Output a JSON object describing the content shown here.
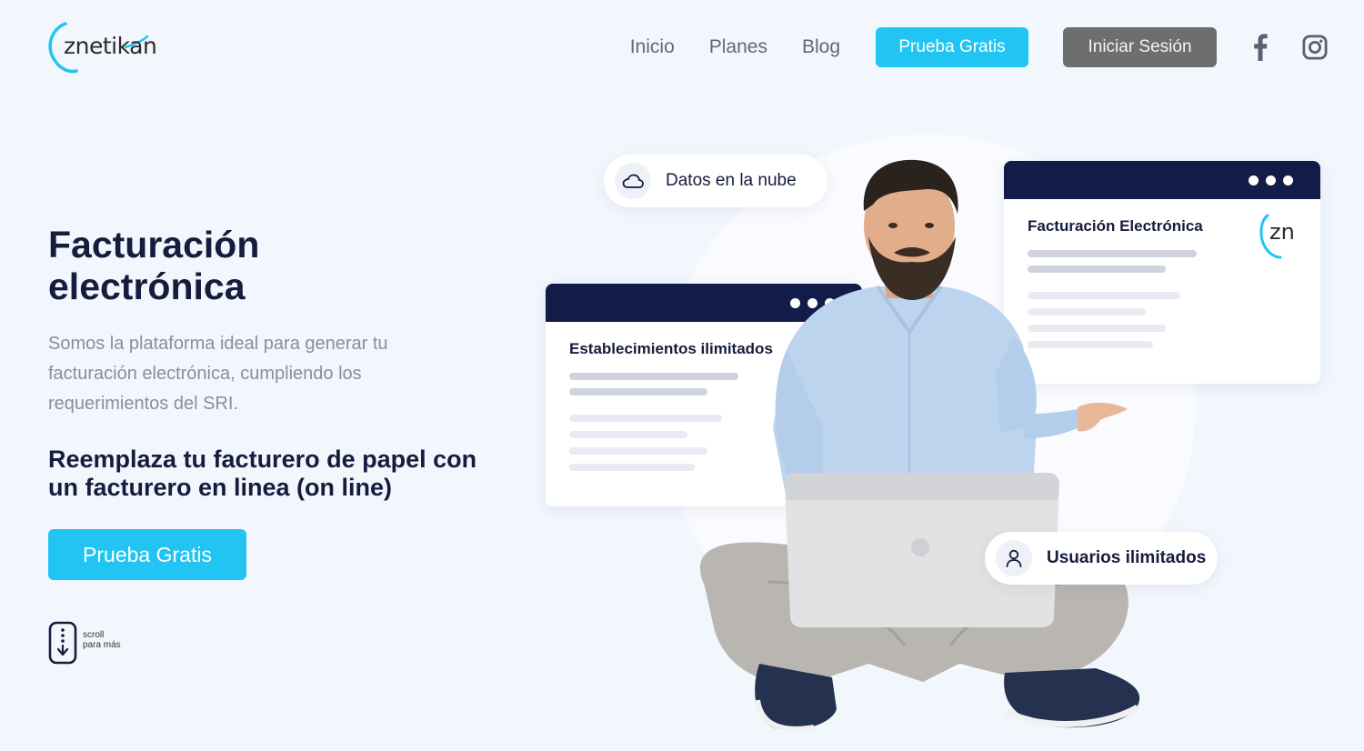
{
  "header": {
    "logo_text": "znetikan",
    "nav": [
      "Inicio",
      "Planes",
      "Blog"
    ],
    "trial_button": "Prueba Gratis",
    "login_button": "Iniciar Sesión",
    "social": [
      "facebook-icon",
      "instagram-icon"
    ]
  },
  "hero": {
    "title": "Facturación electrónica",
    "description": "Somos la plataforma ideal para generar tu facturación electrónica, cumpliendo los requerimientos del SRI.",
    "subtitle": "Reemplaza tu facturero de papel con un facturero en linea (on line)",
    "cta": "Prueba Gratis",
    "scroll_line1": "scroll",
    "scroll_line2": "para más"
  },
  "illustration": {
    "cloud_pill": "Datos en la nube",
    "users_pill": "Usuarios ilimitados",
    "card_left_title": "Establecimientos ilimitados",
    "card_right_title": "Facturación Electrónica",
    "card_right_logo": "zn"
  },
  "colors": {
    "accent": "#21c4f3",
    "navy": "#131c48",
    "login_gray": "#6e6e6e",
    "background": "#f2f6fd"
  }
}
